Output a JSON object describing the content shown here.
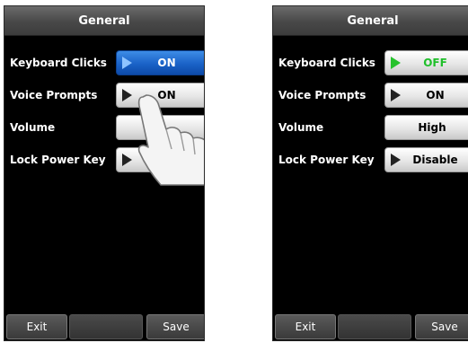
{
  "screens": [
    {
      "title": "General",
      "settings": [
        {
          "label": "Keyboard Clicks",
          "value": "ON",
          "state": "pressed"
        },
        {
          "label": "Voice Prompts",
          "value": "ON"
        },
        {
          "label": "Volume",
          "value": ""
        },
        {
          "label": "Lock Power Key",
          "value": "D"
        }
      ],
      "exit_label": "Exit",
      "save_label": "Save"
    },
    {
      "title": "General",
      "settings": [
        {
          "label": "Keyboard Clicks",
          "value": "OFF",
          "value_color": "#1fbf2a"
        },
        {
          "label": "Voice Prompts",
          "value": "ON"
        },
        {
          "label": "Volume",
          "value": "High"
        },
        {
          "label": "Lock Power Key",
          "value": "Disable"
        }
      ],
      "exit_label": "Exit",
      "save_label": "Save"
    }
  ],
  "icons": {
    "dropdown_arrow": "play-arrow-icon",
    "touch_hand": "pointing-hand-icon"
  }
}
